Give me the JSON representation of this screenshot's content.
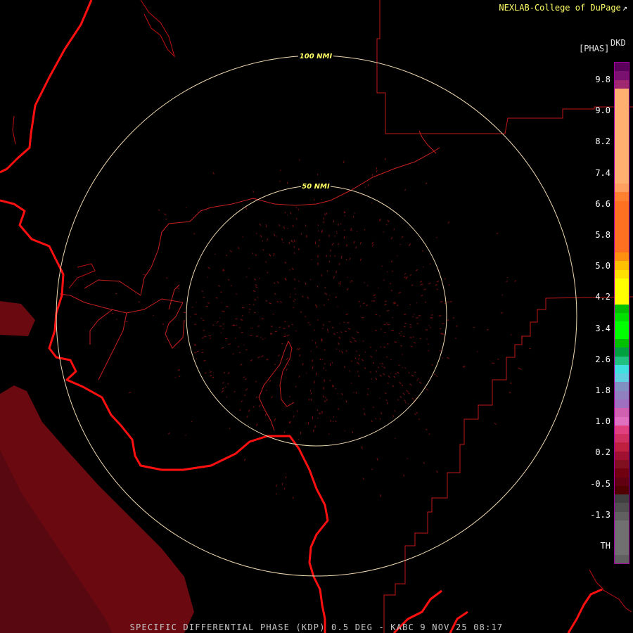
{
  "header": {
    "credit": "NEXLAB-College of DuPage",
    "credit_icon": "external-link-icon"
  },
  "footer": {
    "caption": "SPECIFIC DIFFERENTIAL PHASE (KDP) 0.5 DEG - KABC 9 NOV 25 08:17"
  },
  "range_rings": [
    {
      "label": "100 NMI"
    },
    {
      "label": "50 NMI"
    }
  ],
  "legend": {
    "product": "DKD",
    "unit": "[PHAS]",
    "ticks": [
      "9.8",
      "9.0",
      "8.2",
      "7.4",
      "6.6",
      "5.8",
      "5.0",
      "4.2",
      "3.4",
      "2.6",
      "1.8",
      "1.0",
      "0.2",
      "-0.5",
      "-1.3",
      "TH"
    ],
    "colors": [
      "#5a005a",
      "#7a1070",
      "#a02870",
      "#ffb070",
      "#ffb070",
      "#ffb070",
      "#ffb070",
      "#ffb070",
      "#ffb070",
      "#ffb070",
      "#ffb070",
      "#ffb070",
      "#ffb070",
      "#ffb070",
      "#ffa060",
      "#ff8030",
      "#ff7020",
      "#ff7020",
      "#ff7020",
      "#ff7020",
      "#ff7020",
      "#ff7020",
      "#ff9010",
      "#ffc000",
      "#ffe000",
      "#ffff00",
      "#ffff00",
      "#ffff00",
      "#00c000",
      "#00e000",
      "#00ff00",
      "#00ff00",
      "#00c000",
      "#00a040",
      "#20c080",
      "#40e0e0",
      "#60d0e0",
      "#8090c0",
      "#9080c0",
      "#a070c0",
      "#d060b0",
      "#e070c0",
      "#e04080",
      "#d03060",
      "#c02040",
      "#a01030",
      "#801020",
      "#700010",
      "#600010",
      "#500000",
      "#404040",
      "#505050",
      "#606060",
      "#707070",
      "#707070",
      "#707070",
      "#707070",
      "#606060"
    ]
  },
  "map_colors": {
    "coast": "#ff1010",
    "borders": "#c01818",
    "rivers": "#c82020",
    "rings": "#f0d8b0",
    "echo": "#6a0a10"
  }
}
